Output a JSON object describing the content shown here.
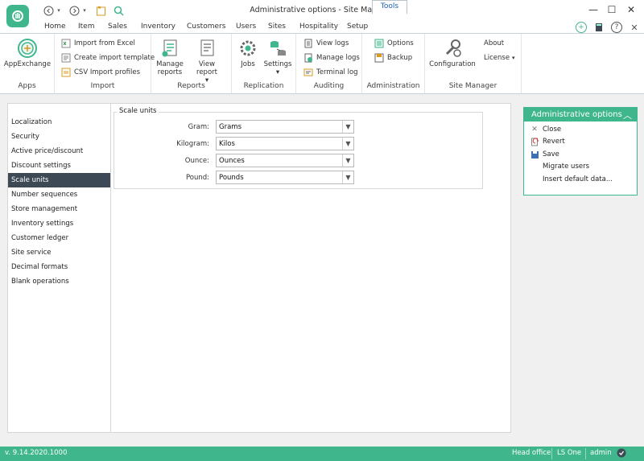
{
  "window": {
    "title": "Administrative options - Site Manager",
    "controls": {
      "minimize": "—",
      "maximize": "☐",
      "close": "✕"
    }
  },
  "menu_tabs": [
    "Home",
    "Item",
    "Sales",
    "Inventory",
    "Customers",
    "Users",
    "Sites",
    "Hospitality",
    "Setup",
    "Tools"
  ],
  "active_tab": "Tools",
  "ribbon": {
    "apps": {
      "label": "Apps",
      "appexchange": "AppExchange"
    },
    "import": {
      "label": "Import",
      "items": [
        "Import from Excel",
        "Create import template",
        "CSV Import profiles"
      ]
    },
    "reports": {
      "label": "Reports",
      "manage": "Manage reports",
      "view": "View report"
    },
    "replication": {
      "label": "Replication",
      "jobs": "Jobs",
      "settings": "Settings"
    },
    "auditing": {
      "label": "Auditing",
      "items": [
        "View logs",
        "Manage logs",
        "Terminal log"
      ]
    },
    "administration": {
      "label": "Administration",
      "options": "Options",
      "backup": "Backup"
    },
    "site_manager": {
      "label": "Site Manager",
      "configuration": "Configuration",
      "about": "About",
      "license": "License"
    }
  },
  "nav_items": [
    "Localization",
    "Security",
    "Active price/discount",
    "Discount settings",
    "Scale units",
    "Number sequences",
    "Store management",
    "Inventory settings",
    "Customer ledger",
    "Site service",
    "Decimal formats",
    "Blank operations"
  ],
  "selected_nav": "Scale units",
  "scale_units": {
    "legend": "Scale units",
    "fields": [
      {
        "label": "Gram:",
        "value": "Grams"
      },
      {
        "label": "Kilogram:",
        "value": "Kilos"
      },
      {
        "label": "Ounce:",
        "value": "Ounces"
      },
      {
        "label": "Pound:",
        "value": "Pounds"
      }
    ]
  },
  "task_panel": {
    "title": "Administrative options",
    "items": [
      "Close",
      "Revert",
      "Save",
      "Migrate users",
      "Insert default data..."
    ]
  },
  "status": {
    "version": "v. 9.14.2020.1000",
    "store": "Head office",
    "product": "LS One",
    "user": "admin"
  },
  "colors": {
    "accent": "#3fb68b",
    "selected_nav": "#3d4a56",
    "tab_text": "#1a5fb4"
  }
}
